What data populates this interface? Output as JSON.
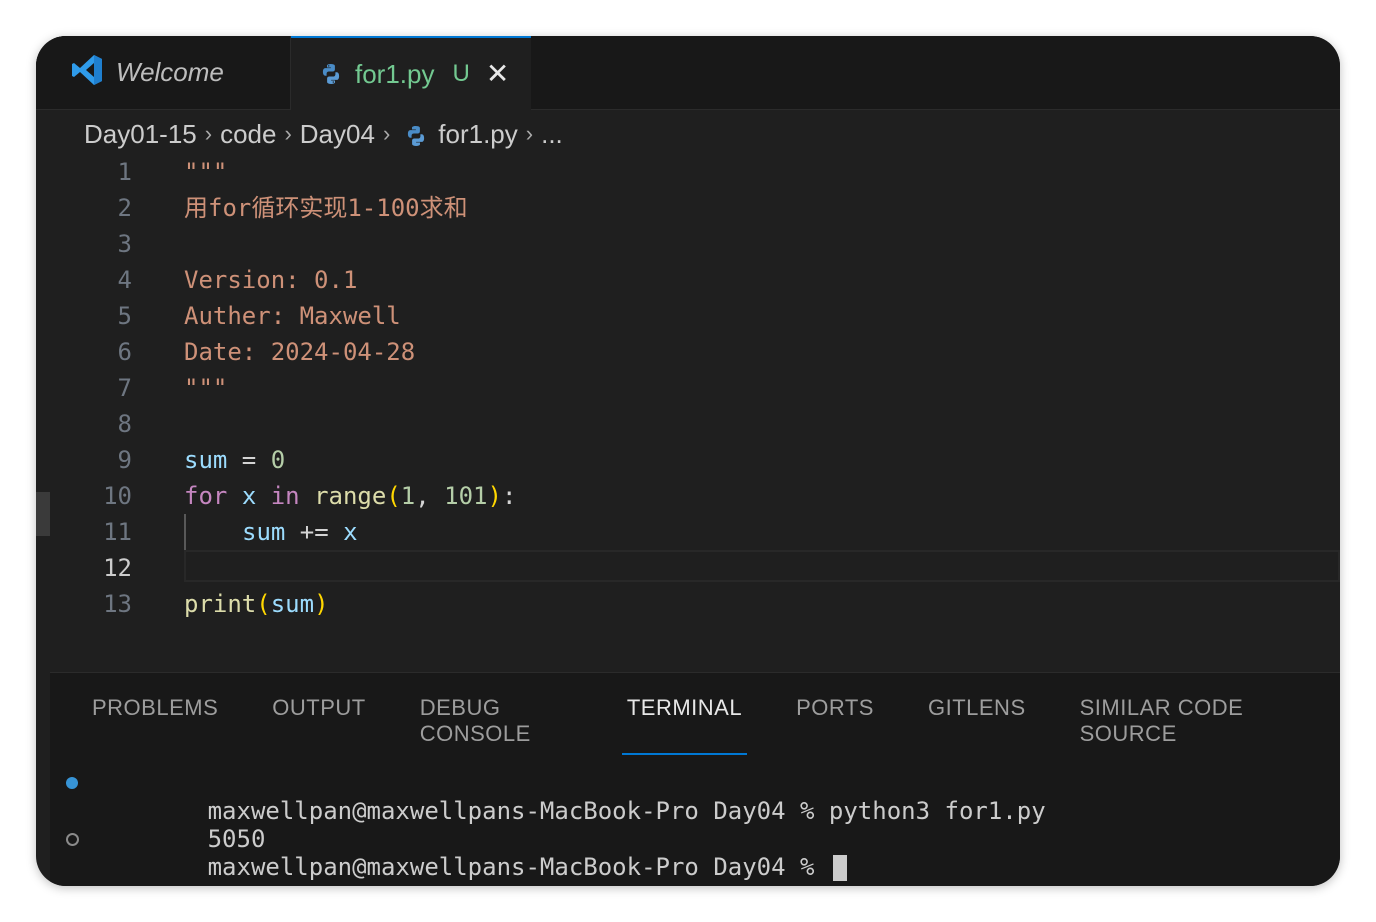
{
  "tabs": {
    "welcome": {
      "label": "Welcome",
      "icon": "vscode-logo-icon"
    },
    "active": {
      "label": "for1.py",
      "status": "U",
      "close": "✕",
      "icon": "python-icon"
    }
  },
  "breadcrumb": [
    "Day01-15",
    "code",
    "Day04",
    "for1.py",
    "..."
  ],
  "editor": {
    "current_line": 12,
    "line_numbers": [
      "1",
      "2",
      "3",
      "4",
      "5",
      "6",
      "7",
      "8",
      "9",
      "10",
      "11",
      "12",
      "13"
    ],
    "lines": {
      "l1": "\"\"\"",
      "l2": "用for循环实现1-100求和",
      "l4": "Version: 0.1",
      "l5": "Auther: Maxwell",
      "l6": "Date: 2024-04-28",
      "l7": "\"\"\"",
      "l9_var": "sum",
      "l9_op": " = ",
      "l9_num": "0",
      "l10_kw": "for",
      "l10_var": "x",
      "l10_kw2": "in",
      "l10_fn": "range",
      "l10_open": "(",
      "l10_a": "1",
      "l10_comma": ", ",
      "l10_b": "101",
      "l10_close": ")",
      "l10_colon": ":",
      "l11_var": "sum",
      "l11_op": " += ",
      "l11_var2": "x",
      "l13_fn": "print",
      "l13_open": "(",
      "l13_var": "sum",
      "l13_close": ")"
    }
  },
  "panel": {
    "tabs": [
      "PROBLEMS",
      "OUTPUT",
      "DEBUG CONSOLE",
      "TERMINAL",
      "PORTS",
      "GITLENS",
      "SIMILAR CODE SOURCE"
    ],
    "active_tab": "TERMINAL"
  },
  "terminal": {
    "line1": "maxwellpan@maxwellpans-MacBook-Pro Day04 % python3 for1.py",
    "line2": "5050",
    "line3": "maxwellpan@maxwellpans-MacBook-Pro Day04 % "
  },
  "colors": {
    "accent": "#0078d4",
    "untracked": "#73c991",
    "string": "#ce9178",
    "variable": "#9cdcfe",
    "number": "#b5cea8",
    "keyword": "#c586c0",
    "function": "#dcdcaa"
  }
}
